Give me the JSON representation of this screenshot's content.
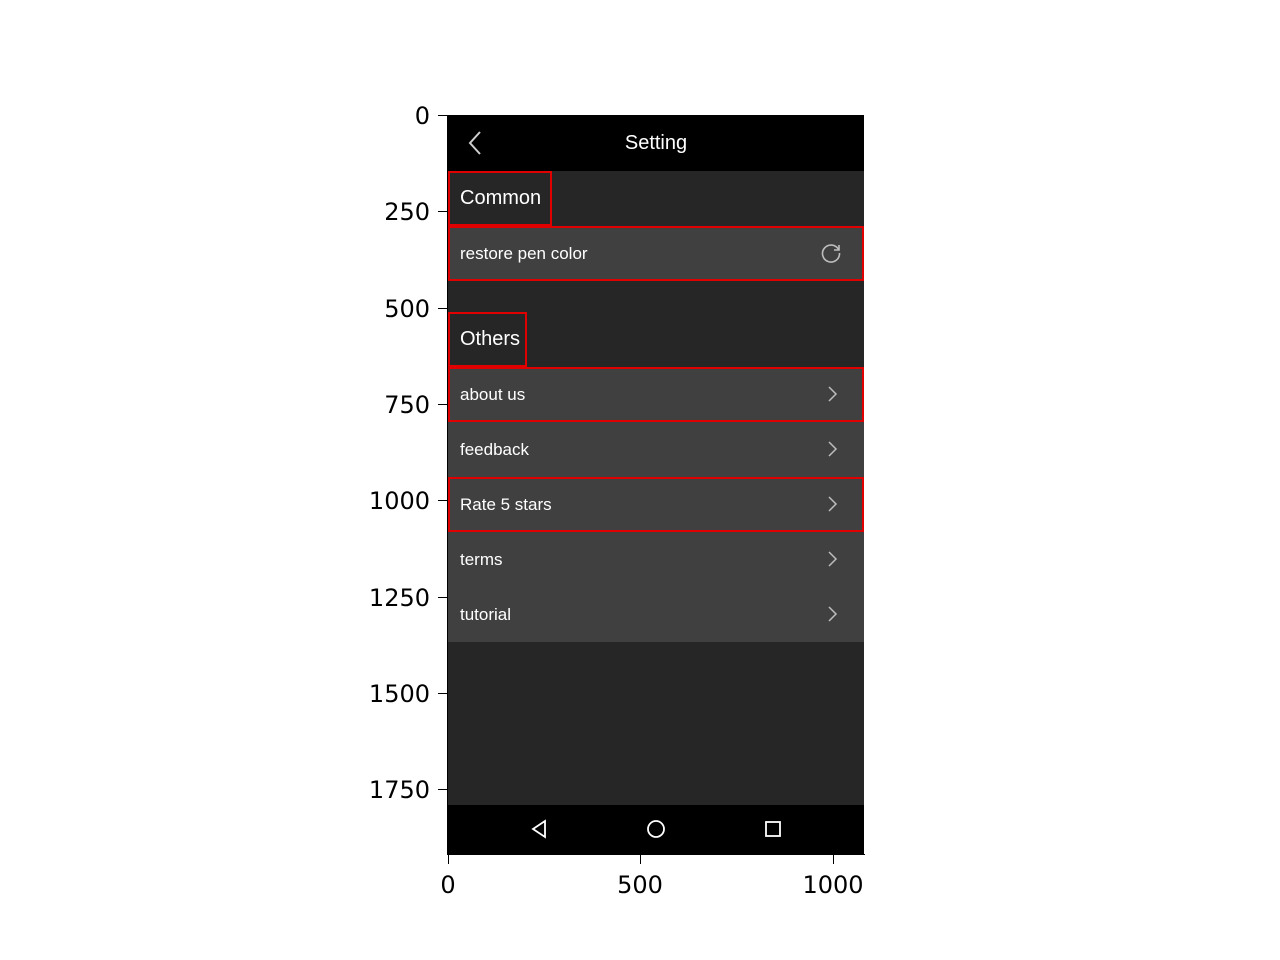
{
  "app": {
    "title": "Setting"
  },
  "sections": {
    "common": {
      "header": "Common",
      "items": [
        {
          "label": "restore pen color",
          "icon": "refresh-icon"
        }
      ]
    },
    "others": {
      "header": "Others",
      "items": [
        {
          "label": "about us",
          "icon": "chevron-right-icon"
        },
        {
          "label": "feedback",
          "icon": "chevron-right-icon"
        },
        {
          "label": "Rate 5 stars",
          "icon": "chevron-right-icon"
        },
        {
          "label": "terms",
          "icon": "chevron-right-icon"
        },
        {
          "label": "tutorial",
          "icon": "chevron-right-icon"
        }
      ]
    }
  },
  "nav": {
    "buttons": [
      "back-triangle-icon",
      "home-circle-icon",
      "recents-square-icon"
    ]
  },
  "axes": {
    "y_ticks": [
      "0",
      "250",
      "500",
      "750",
      "1000",
      "1250",
      "1500",
      "1750"
    ],
    "x_ticks": [
      "0",
      "500",
      "1000"
    ]
  },
  "colors": {
    "app_bar": "#000000",
    "background": "#262626",
    "row": "#404040",
    "highlight_box": "#e00000",
    "text": "#ffffff"
  }
}
